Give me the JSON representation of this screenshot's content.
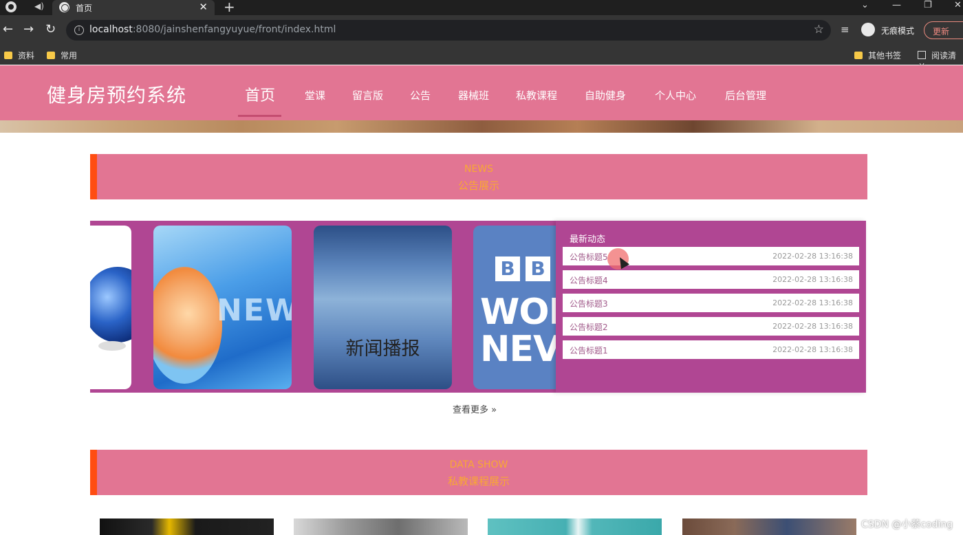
{
  "browser": {
    "tab_title": "首页",
    "url_host": "localhost",
    "url_rest": ":8080/jainshenfangyuyue/front/index.html",
    "incognito_label": "无痕模式",
    "update_label": "更新",
    "bookmarks": [
      "资料",
      "常用"
    ],
    "other_bookmarks": "其他书签",
    "reading_list": "阅读清单"
  },
  "site": {
    "brand": "健身房预约系统",
    "nav": [
      "首页",
      "堂课",
      "留言版",
      "公告",
      "器械班",
      "私教课程",
      "自助健身",
      "个人中心",
      "后台管理"
    ]
  },
  "news_section": {
    "en": "NEWS",
    "cn": "公告展示",
    "carousel_text": "新闻播报",
    "carousel_word": "NEW",
    "bbc_letters": [
      "B",
      "B"
    ],
    "bbc_line1": "WOR",
    "bbc_line2": "NEV",
    "latest_title": "最新动态",
    "items": [
      {
        "title": "公告标题5",
        "date": "2022-02-28 13:16:38"
      },
      {
        "title": "公告标题4",
        "date": "2022-02-28 13:16:38"
      },
      {
        "title": "公告标题3",
        "date": "2022-02-28 13:16:38"
      },
      {
        "title": "公告标题2",
        "date": "2022-02-28 13:16:38"
      },
      {
        "title": "公告标题1",
        "date": "2022-02-28 13:16:38"
      }
    ],
    "more": "查看更多"
  },
  "data_section": {
    "en": "DATA SHOW",
    "cn": "私教课程展示"
  },
  "watermark": "CSDN @小蔡coding",
  "colors": {
    "header_pink": "#e27593",
    "panel_purple": "#b04693",
    "section_text": "#f8a833",
    "accent_bar": "#ff4d12"
  }
}
